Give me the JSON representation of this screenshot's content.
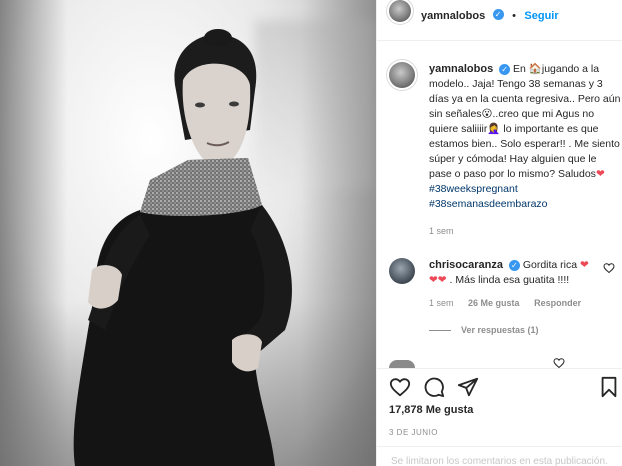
{
  "post": {
    "username": "yamnalobos",
    "follow_label": "Seguir",
    "separator": "•",
    "caption_parts": {
      "a": "En ",
      "b": "jugando a la modelo.. Jaja! Tengo 38 semanas y 3 días ya en la cuenta regresiva.. Pero aún sin señales",
      "c": "..creo que mi Agus no quiere saliiiir",
      "d": " lo importante es que estamos bien.. Solo esperar!! . Me siento súper y cómoda! Hay alguien que le pase o paso por lo mismo? Saludos",
      "tag1": "#38weekspregnant",
      "tag2": "#38semanasdeembarazo"
    },
    "caption_time": "1 sem"
  },
  "comment": {
    "username": "chrisocaranza",
    "text_a": " Gordita rica ",
    "text_b": " . Más linda esa guatita !!!!",
    "time": "1 sem",
    "likes": "26 Me gusta",
    "replies": "Ver respuestas (1)"
  },
  "footer": {
    "likes": "17,878 Me gusta",
    "date": "3 DE JUNIO",
    "limited": "Se limitaron los comentarios en esta publicación."
  },
  "colors": {
    "accent": "#0095f6",
    "verified": "#3897f0",
    "heart": "#ed4956"
  }
}
